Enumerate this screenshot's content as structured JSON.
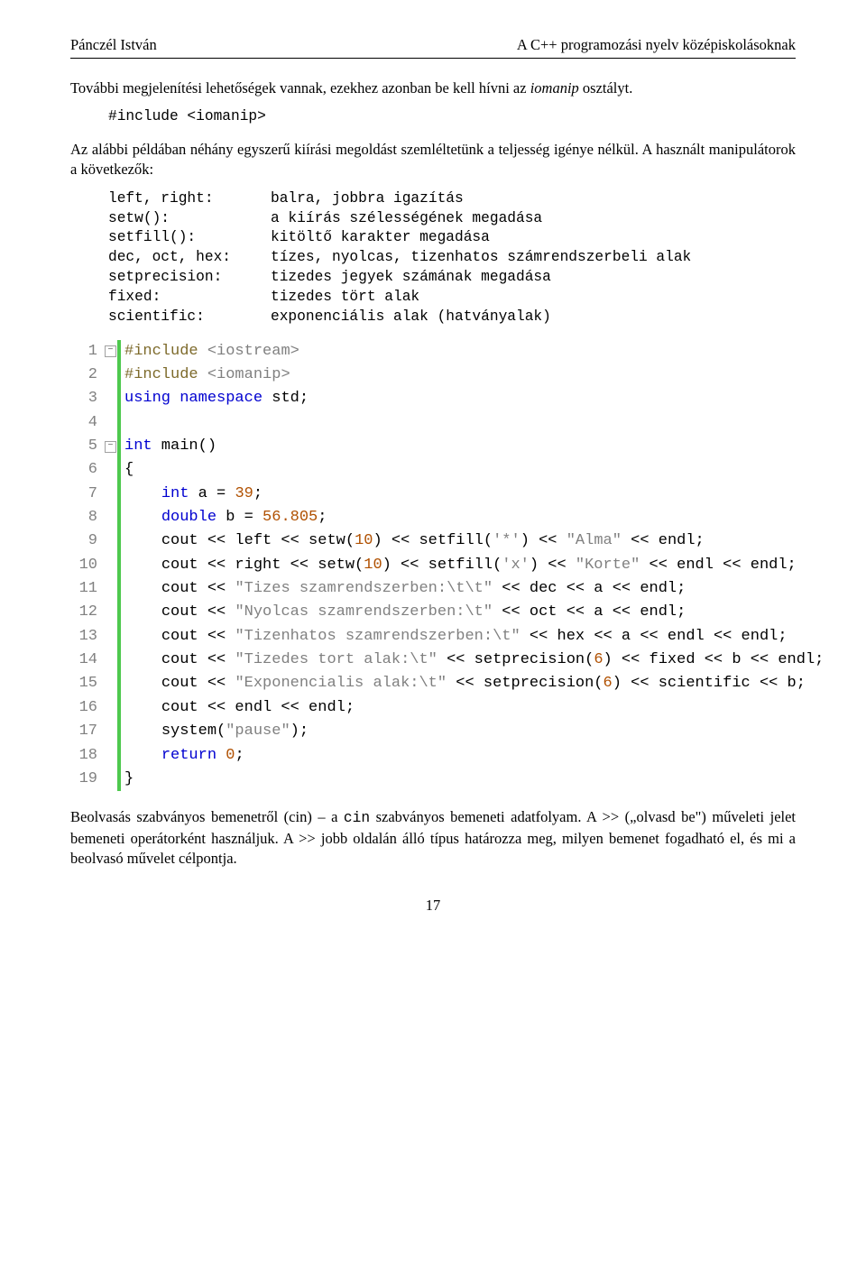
{
  "header": {
    "left": "Pánczél István",
    "right": "A C++ programozási nyelv középiskolásoknak"
  },
  "para1_a": "További megjelenítési lehetőségek vannak, ezekhez azonban be kell hívni az ",
  "para1_b": "iomanip",
  "para1_c": " osztályt.",
  "code1": "#include <iomanip>",
  "para2": "Az alábbi példában néhány egyszerű kiírási megoldást szemléltetünk a teljesség igénye nélkül. A használt manipulátorok a következők:",
  "manips": [
    {
      "k": "left, right:",
      "v": "balra, jobbra igazítás"
    },
    {
      "k": "setw():",
      "v": "a kiírás szélességének megadása"
    },
    {
      "k": "setfill():",
      "v": "kitöltő karakter megadása"
    },
    {
      "k": "dec, oct, hex:",
      "v": "tízes, nyolcas, tizenhatos számrendszerbeli alak"
    },
    {
      "k": "setprecision:",
      "v": "tizedes jegyek számának megadása"
    },
    {
      "k": "fixed:",
      "v": "tizedes tört alak"
    },
    {
      "k": "scientific:",
      "v": "exponenciális alak (hatványalak)"
    }
  ],
  "editor": {
    "lines": [
      {
        "n": "1",
        "fold": "-",
        "tokens": [
          {
            "c": "pp",
            "t": "#include"
          },
          {
            "c": "",
            "t": " "
          },
          {
            "c": "str",
            "t": "<iostream>"
          }
        ]
      },
      {
        "n": "2",
        "tokens": [
          {
            "c": "pp",
            "t": "#include"
          },
          {
            "c": "",
            "t": " "
          },
          {
            "c": "str",
            "t": "<iomanip>"
          }
        ]
      },
      {
        "n": "3",
        "tokens": [
          {
            "c": "kw",
            "t": "using"
          },
          {
            "c": "",
            "t": " "
          },
          {
            "c": "kw",
            "t": "namespace"
          },
          {
            "c": "",
            "t": " std;"
          }
        ]
      },
      {
        "n": "4",
        "tokens": [
          {
            "c": "",
            "t": ""
          }
        ]
      },
      {
        "n": "5",
        "fold": "-",
        "tokens": [
          {
            "c": "kw",
            "t": "int"
          },
          {
            "c": "",
            "t": " main()"
          }
        ]
      },
      {
        "n": "6",
        "tokens": [
          {
            "c": "",
            "t": "{"
          }
        ]
      },
      {
        "n": "7",
        "indent": 1,
        "tokens": [
          {
            "c": "kw",
            "t": "int"
          },
          {
            "c": "",
            "t": " a = "
          },
          {
            "c": "num",
            "t": "39"
          },
          {
            "c": "",
            "t": ";"
          }
        ]
      },
      {
        "n": "8",
        "indent": 1,
        "tokens": [
          {
            "c": "kw",
            "t": "double"
          },
          {
            "c": "",
            "t": " b = "
          },
          {
            "c": "num",
            "t": "56.805"
          },
          {
            "c": "",
            "t": ";"
          }
        ]
      },
      {
        "n": "9",
        "indent": 1,
        "tokens": [
          {
            "c": "",
            "t": "cout << left << setw("
          },
          {
            "c": "num",
            "t": "10"
          },
          {
            "c": "",
            "t": ") << setfill("
          },
          {
            "c": "str",
            "t": "'*'"
          },
          {
            "c": "",
            "t": ") << "
          },
          {
            "c": "str",
            "t": "\"Alma\""
          },
          {
            "c": "",
            "t": " << endl;"
          }
        ]
      },
      {
        "n": "10",
        "indent": 1,
        "tokens": [
          {
            "c": "",
            "t": "cout << right << setw("
          },
          {
            "c": "num",
            "t": "10"
          },
          {
            "c": "",
            "t": ") << setfill("
          },
          {
            "c": "str",
            "t": "'x'"
          },
          {
            "c": "",
            "t": ") << "
          },
          {
            "c": "str",
            "t": "\"Korte\""
          },
          {
            "c": "",
            "t": " << endl << endl;"
          }
        ]
      },
      {
        "n": "11",
        "indent": 1,
        "tokens": [
          {
            "c": "",
            "t": "cout << "
          },
          {
            "c": "str",
            "t": "\"Tizes szamrendszerben:\\t\\t\""
          },
          {
            "c": "",
            "t": " << dec << a << endl;"
          }
        ]
      },
      {
        "n": "12",
        "indent": 1,
        "tokens": [
          {
            "c": "",
            "t": "cout << "
          },
          {
            "c": "str",
            "t": "\"Nyolcas szamrendszerben:\\t\""
          },
          {
            "c": "",
            "t": " << oct << a << endl;"
          }
        ]
      },
      {
        "n": "13",
        "indent": 1,
        "tokens": [
          {
            "c": "",
            "t": "cout << "
          },
          {
            "c": "str",
            "t": "\"Tizenhatos szamrendszerben:\\t\""
          },
          {
            "c": "",
            "t": " << hex << a << endl << endl;"
          }
        ]
      },
      {
        "n": "14",
        "indent": 1,
        "tokens": [
          {
            "c": "",
            "t": "cout << "
          },
          {
            "c": "str",
            "t": "\"Tizedes tort alak:\\t\""
          },
          {
            "c": "",
            "t": " << setprecision("
          },
          {
            "c": "num",
            "t": "6"
          },
          {
            "c": "",
            "t": ") << fixed << b << endl;"
          }
        ]
      },
      {
        "n": "15",
        "indent": 1,
        "tokens": [
          {
            "c": "",
            "t": "cout << "
          },
          {
            "c": "str",
            "t": "\"Exponencialis alak:\\t\""
          },
          {
            "c": "",
            "t": " << setprecision("
          },
          {
            "c": "num",
            "t": "6"
          },
          {
            "c": "",
            "t": ") << scientific << b;"
          }
        ]
      },
      {
        "n": "16",
        "indent": 1,
        "tokens": [
          {
            "c": "",
            "t": "cout << endl << endl;"
          }
        ]
      },
      {
        "n": "17",
        "indent": 1,
        "tokens": [
          {
            "c": "",
            "t": "system("
          },
          {
            "c": "str",
            "t": "\"pause\""
          },
          {
            "c": "",
            "t": ");"
          }
        ]
      },
      {
        "n": "18",
        "indent": 1,
        "tokens": [
          {
            "c": "kw",
            "t": "return"
          },
          {
            "c": "",
            "t": " "
          },
          {
            "c": "num",
            "t": "0"
          },
          {
            "c": "",
            "t": ";"
          }
        ]
      },
      {
        "n": "19",
        "tokens": [
          {
            "c": "",
            "t": "}"
          }
        ]
      }
    ]
  },
  "para3_a": "Beolvasás szabványos bemenetről (cin) – a ",
  "para3_b": "cin",
  "para3_c": " szabványos bemeneti adatfolyam. A >> („olvasd be\") műveleti jelet bemeneti operátorként használjuk. A >> jobb oldalán álló típus határozza meg, milyen bemenet fogadható el, és mi a beolvasó művelet célpontja.",
  "pagenum": "17"
}
